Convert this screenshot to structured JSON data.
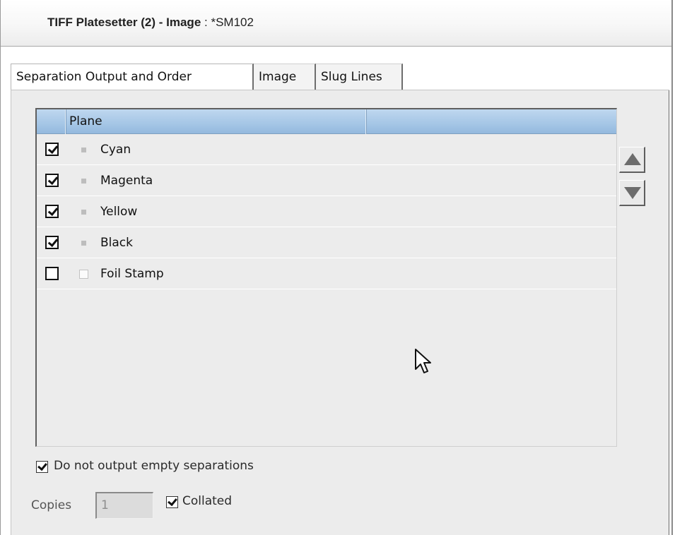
{
  "window": {
    "title_bold": "TIFF Platesetter (2) - Image",
    "title_rest": " : *SM102"
  },
  "tabs": [
    {
      "label": "Separation Output and Order",
      "active": true
    },
    {
      "label": "Image",
      "active": false
    },
    {
      "label": "Slug Lines",
      "active": false
    }
  ],
  "plane_list": {
    "header": "Plane",
    "rows": [
      {
        "label": "Cyan",
        "checked": true
      },
      {
        "label": "Magenta",
        "checked": true
      },
      {
        "label": "Yellow",
        "checked": true
      },
      {
        "label": "Black",
        "checked": true
      },
      {
        "label": "Foil Stamp",
        "checked": false
      }
    ]
  },
  "buttons": {
    "move_up_icon": "triangle-up-icon",
    "move_down_icon": "triangle-down-icon"
  },
  "options": {
    "empty_separations_label": "Do not output empty separations",
    "empty_separations_checked": true,
    "copies_label": "Copies",
    "copies_value": "1",
    "collated_label": "Collated",
    "collated_checked": true
  }
}
